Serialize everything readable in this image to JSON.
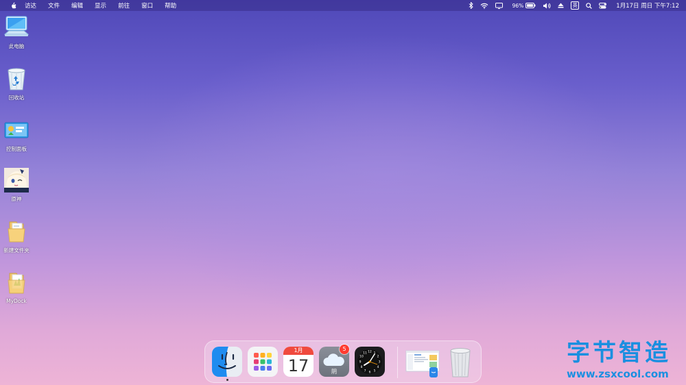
{
  "menubar": {
    "items": [
      "访达",
      "文件",
      "编辑",
      "显示",
      "前往",
      "窗口",
      "帮助"
    ],
    "battery_percent": "96%",
    "ime_label": "英",
    "clock": "1月17日 周日 下午7:12"
  },
  "desktop_icons": [
    {
      "label": "此电脑",
      "icon": "computer-icon"
    },
    {
      "label": "回收站",
      "icon": "recycle-bin-icon"
    },
    {
      "label": "控制面板",
      "icon": "control-panel-icon"
    },
    {
      "label": "原神",
      "icon": "genshin-app-icon"
    },
    {
      "label": "新建文件夹",
      "icon": "folder-icon"
    },
    {
      "label": "MyDock",
      "icon": "mydock-folder-icon"
    }
  ],
  "dock": {
    "apps": [
      {
        "name": "finder-icon"
      },
      {
        "name": "launchpad-icon"
      },
      {
        "name": "calendar-icon",
        "month": "1月",
        "day": "17"
      },
      {
        "name": "weather-icon",
        "condition": "阴",
        "badge": "5"
      },
      {
        "name": "clock-app-icon"
      },
      {
        "name": "window-thumbnail-icon"
      },
      {
        "name": "trash-icon"
      }
    ]
  },
  "watermark": {
    "title": "字节智造",
    "url": "www.zsxcool.com"
  },
  "colors": {
    "watermark": "#1a8fe0",
    "badge": "#ff3b30"
  }
}
